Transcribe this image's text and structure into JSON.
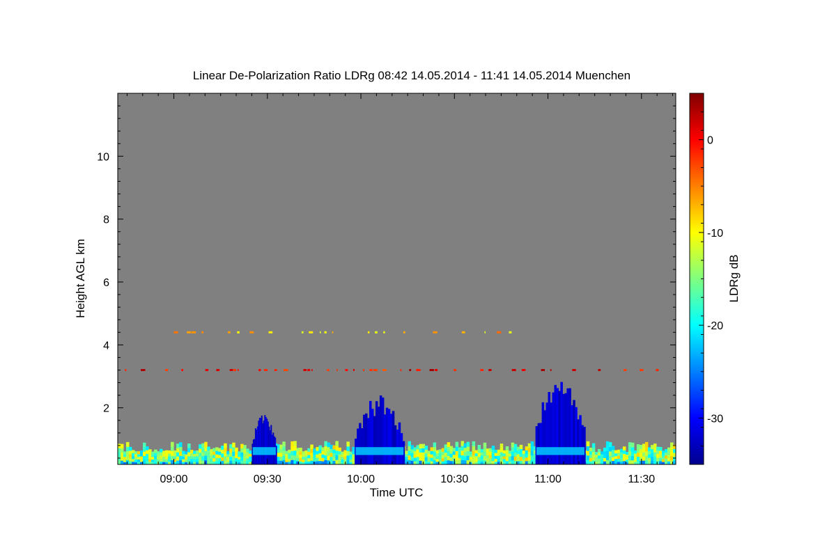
{
  "chart_data": {
    "type": "heatmap",
    "title": "Linear De-Polarization Ratio LDRg   08:42 14.05.2014 - 11:41 14.05.2014 Muenchen",
    "xlabel": "Time UTC",
    "ylabel": "Height AGL km",
    "x_ticks": [
      "09:00",
      "09:30",
      "10:00",
      "10:30",
      "11:00",
      "11:30"
    ],
    "x_tick_values": [
      540,
      570,
      600,
      630,
      660,
      690
    ],
    "xlim": [
      522,
      701
    ],
    "y_ticks": [
      2,
      4,
      6,
      8,
      10
    ],
    "ylim": [
      0.2,
      12
    ],
    "colorbar": {
      "label": "LDRg dB",
      "ticks": [
        0,
        -10,
        -20,
        -30
      ],
      "range": [
        -35,
        5
      ]
    },
    "background_color": "#808080",
    "grid": false,
    "features": [
      {
        "label": "aerosol boundary layer",
        "t_start": 522,
        "t_end": 701,
        "h_bottom": 0.2,
        "h_top": 0.7,
        "ldr": -15
      },
      {
        "label": "layer ~3.2 km",
        "t_start": 522,
        "t_end": 700,
        "height": 3.2,
        "ldr": 0
      },
      {
        "label": "layer ~4.4 km",
        "t_start": 540,
        "t_end": 650,
        "height": 4.4,
        "ldr": -8
      },
      {
        "label": "cloud 09:30",
        "t_start": 565,
        "t_end": 573,
        "h_bottom": 0.2,
        "h_top": 1.8,
        "ldr": -32
      },
      {
        "label": "cloud 10:00",
        "t_start": 598,
        "t_end": 614,
        "h_bottom": 0.2,
        "h_top": 2.3,
        "ldr": -32
      },
      {
        "label": "cloud 11:00",
        "t_start": 656,
        "t_end": 672,
        "h_bottom": 0.2,
        "h_top": 2.9,
        "ldr": -32
      }
    ]
  }
}
